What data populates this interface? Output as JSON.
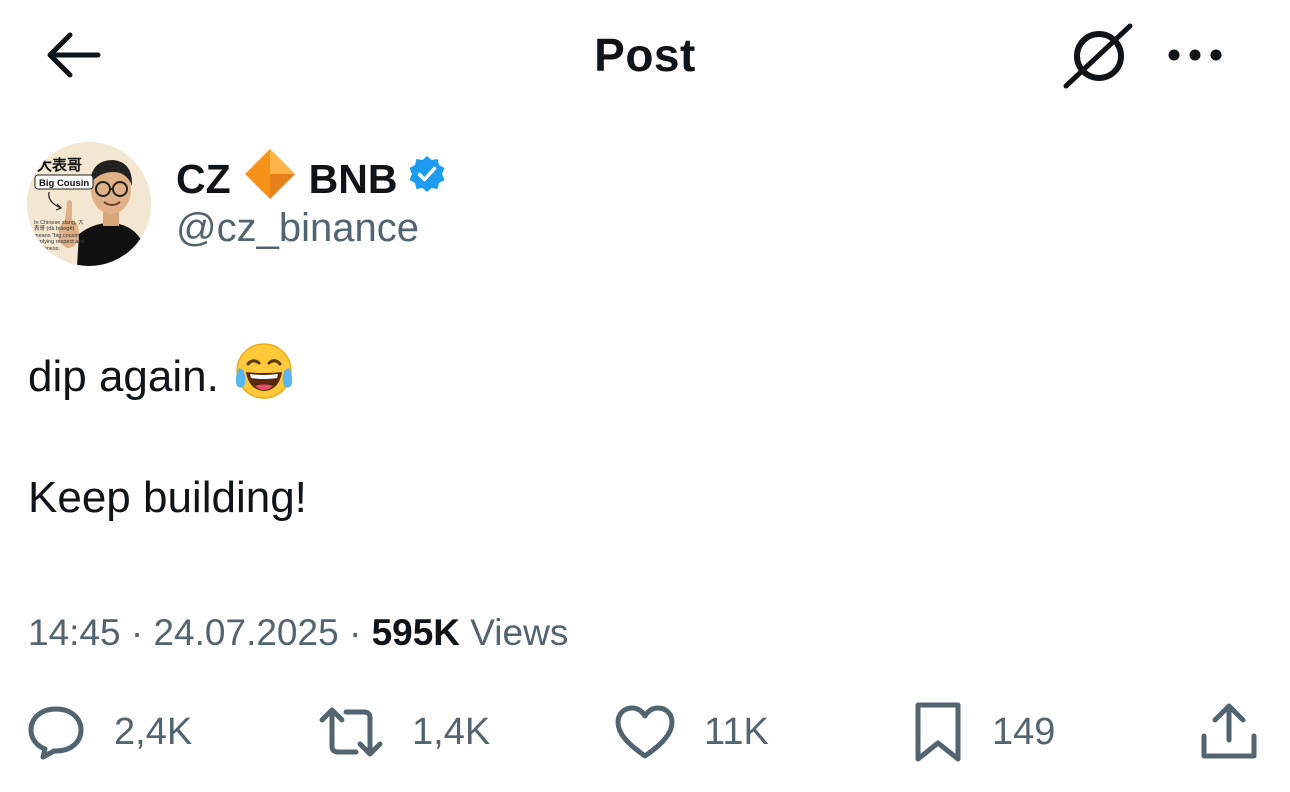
{
  "header": {
    "title": "Post"
  },
  "author": {
    "name_first": "CZ",
    "name_second": "BNB",
    "handle": "@cz_binance",
    "verified": true,
    "avatar_text": {
      "top": "大表哥",
      "label": "Big Cousin",
      "caption": "In Chinese slang, 大表哥 (dà biǎogē) means \"big cousin,\" implying respect and closeness."
    }
  },
  "tweet": {
    "line1": "dip again.",
    "line2": "Keep building!"
  },
  "meta": {
    "time": "14:45",
    "date": "24.07.2025",
    "separator": "·",
    "views_count": "595K",
    "views_label": "Views"
  },
  "actions": {
    "replies": "2,4K",
    "reposts": "1,4K",
    "likes": "11K",
    "bookmarks": "149"
  },
  "colors": {
    "text": "#0f1419",
    "secondary": "#536471",
    "verified": "#1d9bf0",
    "diamond": "#f7931a"
  },
  "icons": [
    "arrow-left-icon",
    "grok-icon",
    "more-icon",
    "diamond-icon",
    "verified-badge-icon",
    "laughing-emoji-icon",
    "reply-icon",
    "repost-icon",
    "like-icon",
    "bookmark-icon",
    "share-icon"
  ]
}
